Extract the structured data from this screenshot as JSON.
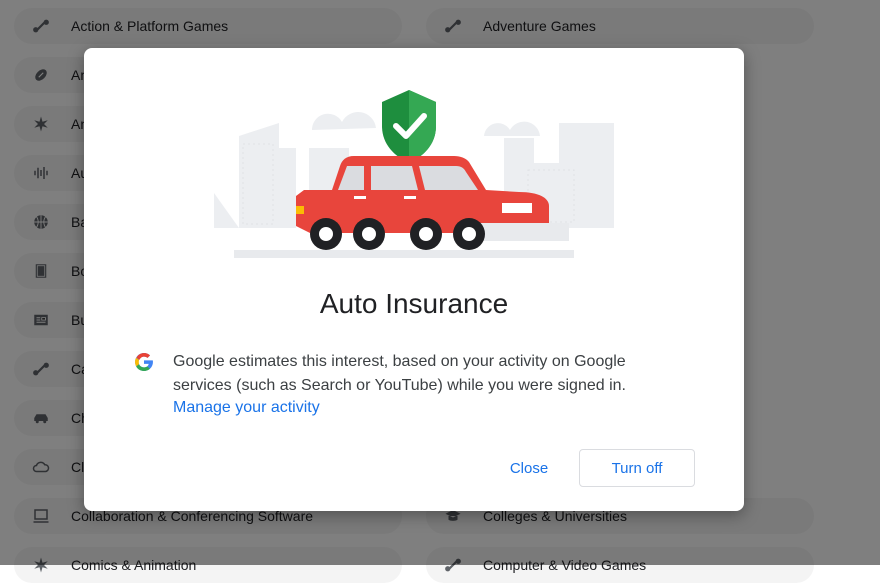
{
  "background_items": [
    {
      "label": "Action & Platform Games",
      "icon": "gamepad-icon"
    },
    {
      "label": "Adventure Games",
      "icon": "gamepad-icon"
    },
    {
      "label": "Ame",
      "icon": "football-icon"
    },
    {
      "label": "Anim",
      "icon": "burst-icon"
    },
    {
      "label": "Aud",
      "icon": "audio-waves-icon"
    },
    {
      "label": "Bask",
      "icon": "basketball-icon"
    },
    {
      "label": "Boo",
      "icon": "book-icon"
    },
    {
      "label": "Busi",
      "icon": "newspaper-icon"
    },
    {
      "label": "Cas",
      "icon": "gamepad-icon"
    },
    {
      "label": "Che",
      "icon": "car-icon"
    },
    {
      "label": "Clou",
      "icon": "cloud-icon"
    },
    {
      "label": "Collaboration & Conferencing Software",
      "icon": "conference-icon"
    },
    {
      "label": "Colleges & Universities",
      "icon": "graduation-cap-icon"
    },
    {
      "label": "Comics & Animation",
      "icon": "burst-icon"
    },
    {
      "label": "Computer & Video Games",
      "icon": "gamepad-icon"
    }
  ],
  "dialog": {
    "title": "Auto Insurance",
    "description": "Google estimates this interest, based on your activity on Google services (such as Search or YouTube) while you were signed in.",
    "manage_link": "Manage your activity",
    "close_label": "Close",
    "turn_off_label": "Turn off"
  },
  "colors": {
    "accent": "#1a73e8",
    "car_red": "#e8453c",
    "shield_green": "#1e8e3e"
  }
}
